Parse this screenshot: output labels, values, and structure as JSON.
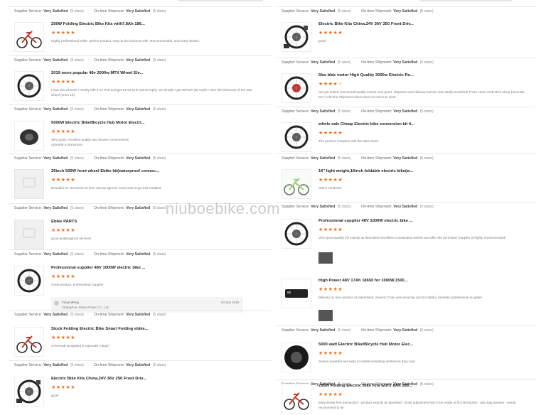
{
  "watermark": "niuboebike.com",
  "labels": {
    "supplier_service": "Supplier Service:",
    "shipment": "On-time Shipment:",
    "very_satisfied": "Very Satisfied",
    "five_stars": "(5 stars)"
  },
  "left": [
    {
      "title": "250W Folding Electric Bike Kits with7.8Ah 186...",
      "rating": 5,
      "review": "Highly professional seller, perfect product, easy to do business with.  Recommended, and many thanks.",
      "thumb": "folding-bike"
    },
    {
      "title": "2019 more popular 48v 2000w MTX Wheel Ele...",
      "rating": 5,
      "review": "I love this wheel!!! I mostly ride it on PAS and get 51-54 kmh (33-34 mph).  On throttle I get 58 kmh (36 mph).  I love the thickness of the rear wheel (2mm 12).",
      "thumb": "wheel-motor"
    },
    {
      "title": "5000W Electric Bike/Bicycle Hub Motor Electri...",
      "rating": 5,
      "review": "Very good, excellent quality and service, recommend!\nAprende a pronunciar",
      "thumb": "hub-motor"
    },
    {
      "title": "26inch 500W front wheel Ebike kit(waterproof connec...",
      "rating": 5,
      "review": "Beautiful kit. Received on time and as agreed. Can't wait to get this installed.",
      "thumb": "placeholder"
    },
    {
      "title": "Ebike PARTS",
      "rating": 5,
      "review": "good quality&good services",
      "thumb": "placeholder"
    },
    {
      "title": "Professional supplier 48V 1000W electric bike ...",
      "rating": 5,
      "review": "Great product, professional Supplier",
      "thumb": "wheel",
      "reply": {
        "name": "Freya Wong",
        "company": "Changzhou Niubo Power Co., Ltd.",
        "date": "04 Sep 2019"
      }
    },
    {
      "title": "Stock Folding Electric Bike Smart Folding ebike...",
      "rating": 5,
      "review": "отличный продавец и хороший товар!!",
      "thumb": "folding-bike"
    },
    {
      "title": "Electric Bike Kits China,24V 36V 250 Front Driv...",
      "rating": 5,
      "review": "good",
      "thumb": "kit"
    }
  ],
  "right": [
    {
      "title": "Electric Bike Kits China,24V 36V 350 Front Driv...",
      "rating": 5,
      "review": "good",
      "thumb": "kit"
    },
    {
      "title": "5kw bldc motor High Quality 3000w Electric Re...",
      "rating": 4,
      "review": "Not yet tested, but overall quality seems very good. Shipment and delivery service was totally excellent! There came USB stick along (manuals etc?) with the Shipment which does not seem to work.",
      "thumb": "red-wheel"
    },
    {
      "title": "whole sale Cheap Electric bike conversion kit 4...",
      "rating": 5,
      "review": "The product complies with the data sheet.",
      "thumb": "wheel"
    },
    {
      "title": "16\" light weight,16inch foldable electric bike(w...",
      "rating": 5,
      "review": "Otimo vendedor",
      "thumb": "green-bike"
    },
    {
      "title": "Professional supplier 48V 1000W electric bike ...",
      "rating": 5,
      "review": "Very good quality! All exactly as described! Excellent consultation before and after the purchase!  Supplier is highly recommended!",
      "thumb": "wheel",
      "attach": true
    },
    {
      "title": "High Power 48V 17Ah 18650 for 1000W,1500...",
      "rating": 5,
      "review": "delivery on time product as advertised.  Season Chan was amazing and so helpful. fantastic professional su pplier.",
      "thumb": "battery",
      "attach": true
    },
    {
      "title": "5000 watt Electric Bike/Bicycle Hub Motor Elec...",
      "rating": 5,
      "review": "Seems powerful and easy to install,everything worked as they said",
      "thumb": "tire"
    },
    {
      "title": "250W Folding Electric Bike Kits with7.8Ah 186...",
      "rating": 5,
      "review": "easy stress free transaction - product exactly as specified - small adjustment has to be made to fit a Brompton - also bag aresant - would recommend to all",
      "thumb": "folding-bike"
    }
  ],
  "colors": {
    "star": "#f36b1c",
    "text": "#333333"
  }
}
